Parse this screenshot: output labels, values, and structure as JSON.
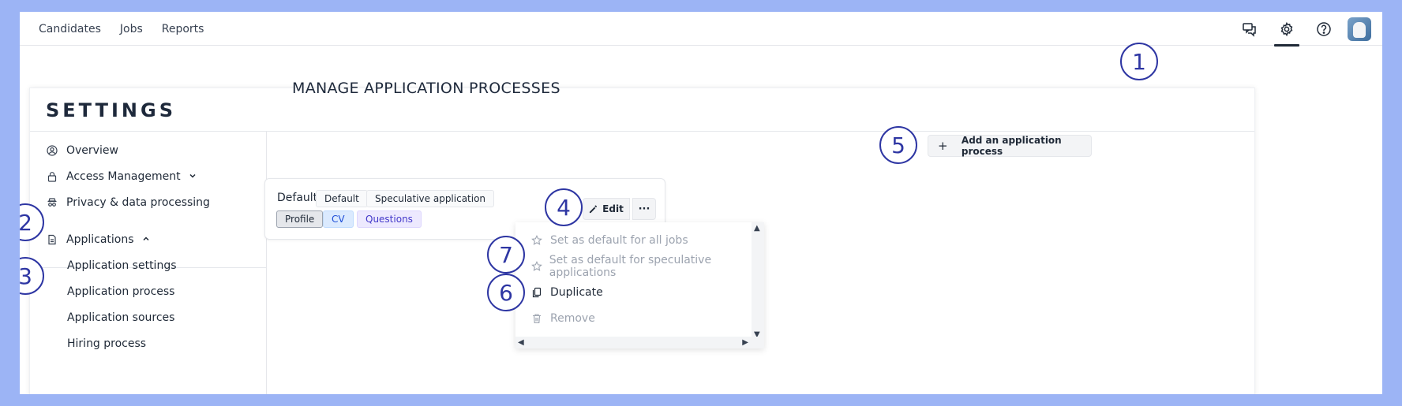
{
  "nav": {
    "items": [
      "Candidates",
      "Jobs",
      "Reports"
    ]
  },
  "top_icons": [
    "chat-icon",
    "gear-icon",
    "help-icon"
  ],
  "settings": {
    "title": "SETTINGS"
  },
  "sidebar": {
    "overview": "Overview",
    "access": "Access Management",
    "privacy": "Privacy & data processing",
    "applications": "Applications",
    "subitems": [
      "Application settings",
      "Application process",
      "Application sources",
      "Hiring process"
    ]
  },
  "main": {
    "title": "MANAGE APPLICATION PROCESSES",
    "add_button": "Add an application process"
  },
  "process_card": {
    "name": "Default",
    "tags_top": [
      "Default",
      "Speculative application"
    ],
    "tags_steps": [
      "Profile",
      "CV",
      "Questions"
    ],
    "edit_label": "Edit",
    "more_label": "···"
  },
  "menu": {
    "items": [
      {
        "label": "Set as default for all jobs",
        "enabled": false
      },
      {
        "label": "Set as default for speculative applications",
        "enabled": false
      },
      {
        "label": "Duplicate",
        "enabled": true
      },
      {
        "label": "Remove",
        "enabled": false
      }
    ]
  },
  "badges": [
    "1",
    "2",
    "3",
    "4",
    "5",
    "6",
    "7"
  ],
  "colors": {
    "accent": "#2e36a3",
    "background": "#9cb4f5"
  }
}
